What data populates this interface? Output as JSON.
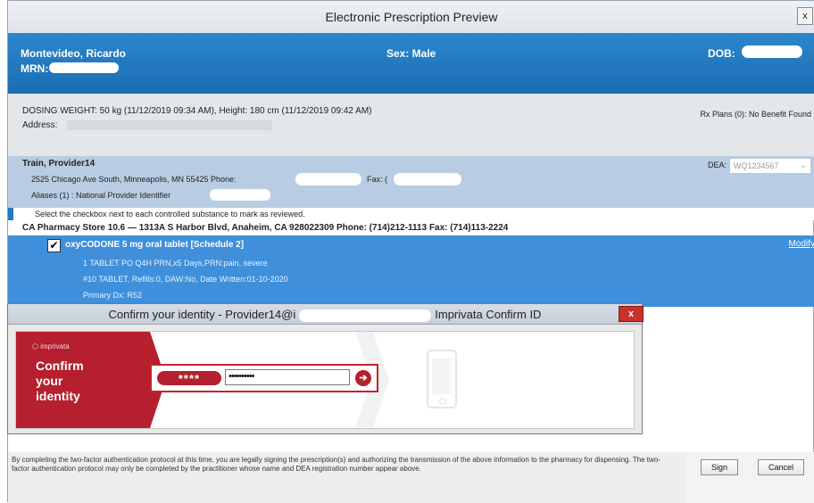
{
  "window": {
    "title": "Electronic Prescription Preview",
    "close_label": "x"
  },
  "patient": {
    "name": "Montevideo, Ricardo",
    "mrn_label": "MRN:",
    "sex": "Sex: Male",
    "dob_label": "DOB:"
  },
  "dosing": {
    "weight_line": "DOSING WEIGHT: 50 kg (11/12/2019 09:34 AM), Height: 180 cm (11/12/2019 09:42 AM)",
    "address_label": "Address:",
    "rx_plans": "Rx Plans (0): No Benefit Found"
  },
  "provider": {
    "name": "Train, Provider14",
    "address": "2525 Chicago Ave South, Minneapolis, MN 55425 Phone:",
    "fax_label": "Fax: (",
    "aliases": "Aliases (1) : National Provider Identifier",
    "dea_label": "DEA:",
    "dea_value": "WQ1234567"
  },
  "instruction": "Select the checkbox next to each controlled substance to mark as reviewed.",
  "pharmacy": "CA Pharmacy Store 10.6 — 1313A S Harbor Blvd, Anaheim, CA 928022309 Phone: (714)212-1113 Fax: (714)113-2224",
  "rx": {
    "checked_mark": "✔",
    "drug": "oxyCODONE 5 mg oral tablet [Schedule 2]",
    "sig": "1 TABLET PO Q4H PRN,x5 Days,PRN:pain, severe",
    "dispense": "#10 TABLET, Refills:0, DAW:No, Date Written:01-10-2020",
    "primary_dx": "Primary Dx: R52",
    "modify_label": "Modify"
  },
  "dialog": {
    "title_left": "Confirm your identity - Provider14@i",
    "title_right": "Imprivata Confirm ID",
    "close_label": "x",
    "logo": "⬡ imprivata",
    "confirm_text": "Confirm\nyour\nidentity",
    "pin_label": "****",
    "pin_value": "••••••••••",
    "go_label": "➔"
  },
  "legal_text": "By completing the two-factor authentication protocol at this time, you are legally signing the prescription(s) and authorizing the transmission of the above information to the pharmacy for dispensing. The two-factor authentication protocol may only be completed by the practitioner whose name and DEA registration number appear above.",
  "buttons": {
    "sign": "Sign",
    "cancel": "Cancel"
  },
  "colors": {
    "header_blue": "#1b6db3",
    "rx_blue": "#3f8fdb",
    "imprivata_red": "#b51f2e"
  }
}
